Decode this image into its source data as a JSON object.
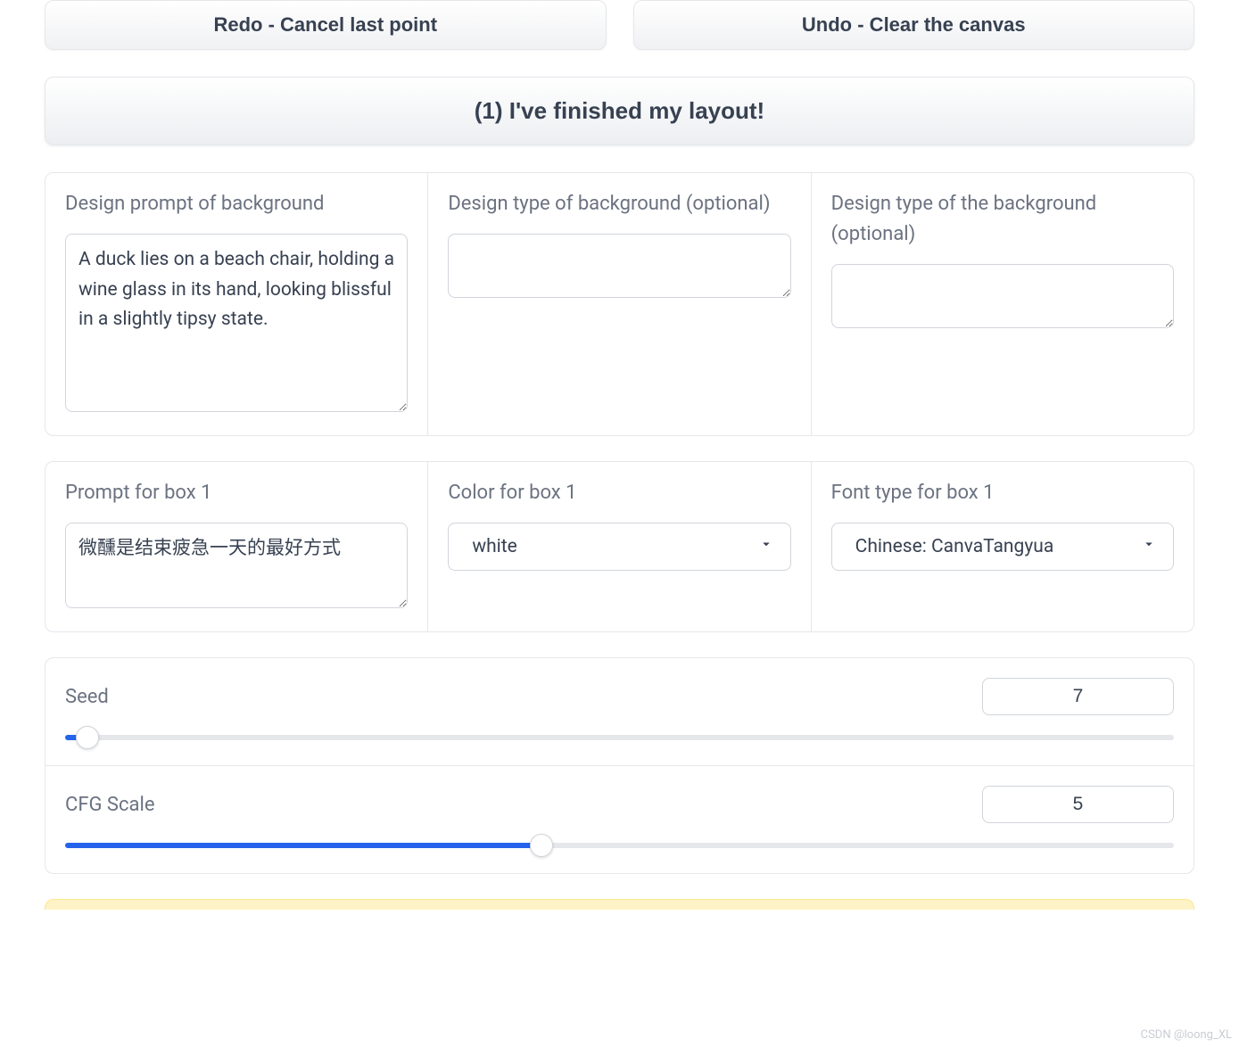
{
  "buttons": {
    "redo": "Redo - Cancel last point",
    "undo": "Undo - Clear the canvas",
    "finished": "(1) I've finished my layout!"
  },
  "background": {
    "prompt_label": "Design prompt of background",
    "prompt_value": "A duck lies on a beach chair, holding a wine glass in its hand, looking blissful in a slightly tipsy state.",
    "type1_label": "Design type of background (optional)",
    "type1_value": "",
    "type2_label": "Design type of the background (optional)",
    "type2_value": ""
  },
  "box1": {
    "prompt_label": "Prompt for box 1",
    "prompt_value": "微醺是结束疲急一天的最好方式",
    "color_label": "Color for box 1",
    "color_value": "white",
    "font_label": "Font type for box 1",
    "font_value": "Chinese: CanvaTangyua"
  },
  "sliders": {
    "seed_label": "Seed",
    "seed_value": "7",
    "seed_percent": 2,
    "cfg_label": "CFG Scale",
    "cfg_value": "5",
    "cfg_percent": 43
  },
  "watermark": "CSDN @loong_XL"
}
